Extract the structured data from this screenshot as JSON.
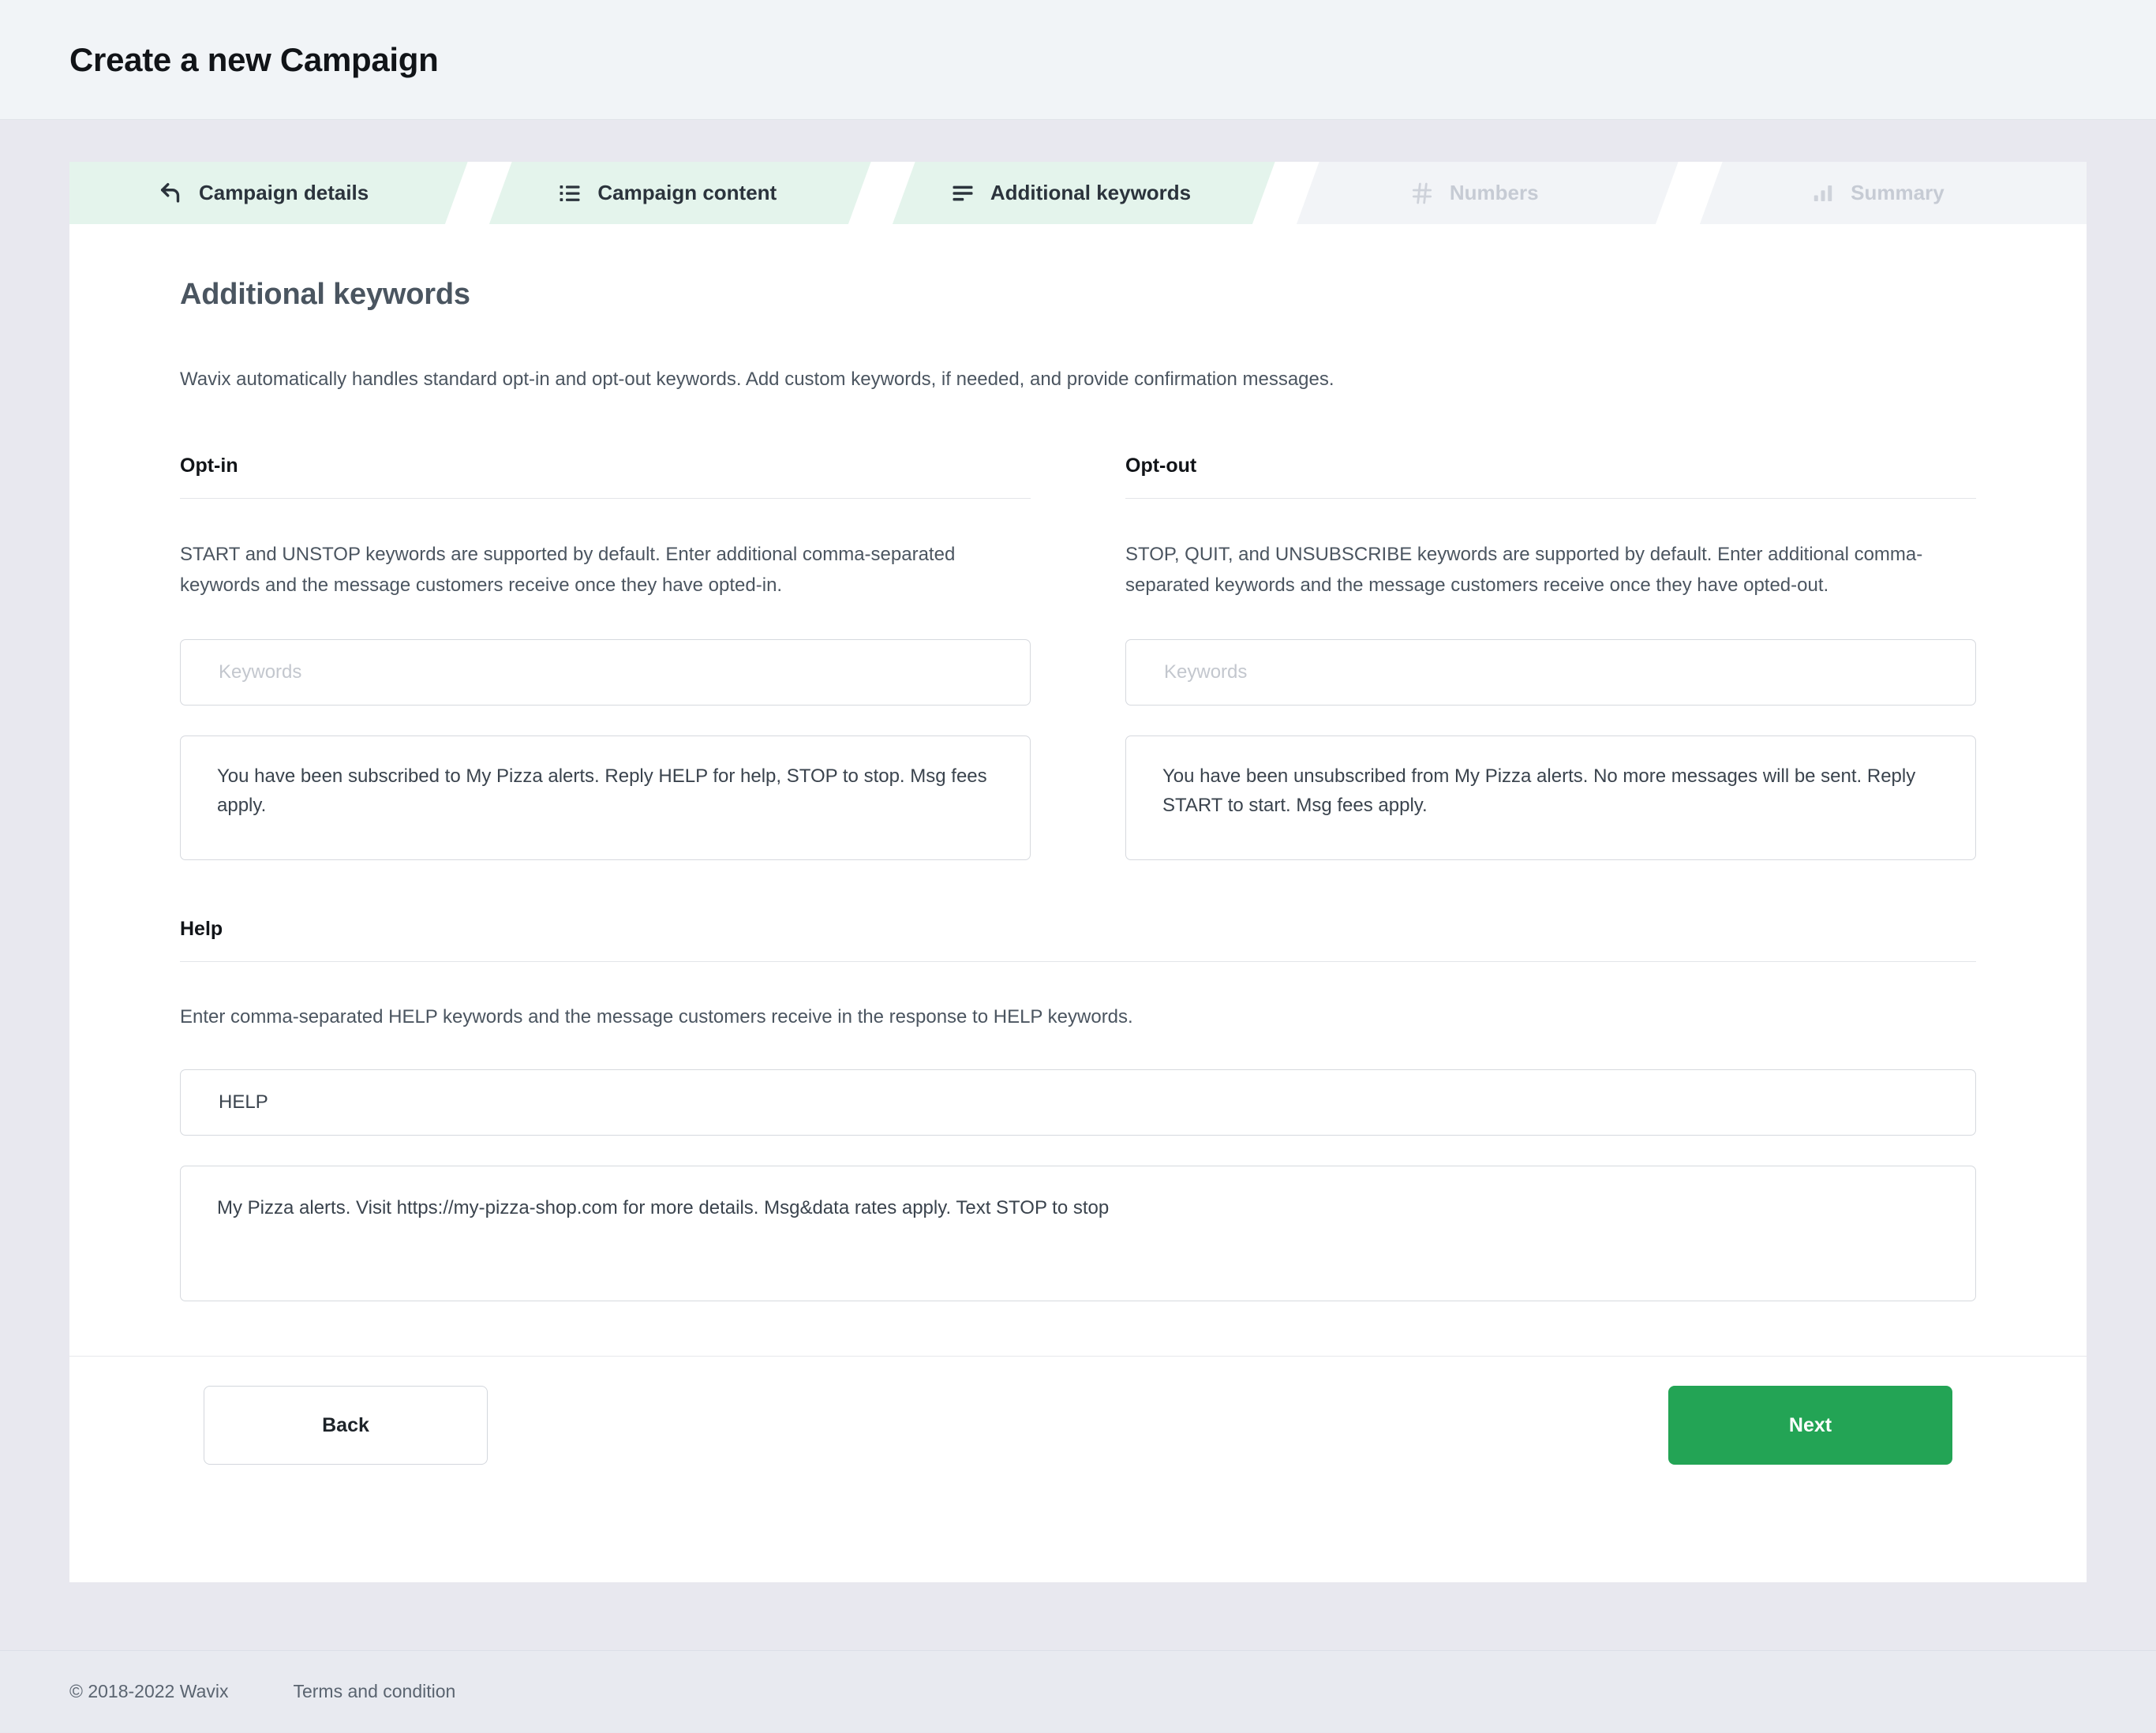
{
  "header": {
    "title": "Create a new Campaign"
  },
  "stepper": {
    "steps": [
      {
        "label": "Campaign details",
        "icon": "back-arrow-icon",
        "state": "active"
      },
      {
        "label": "Campaign content",
        "icon": "bullet-list-icon",
        "state": "active"
      },
      {
        "label": "Additional keywords",
        "icon": "align-left-icon",
        "state": "active"
      },
      {
        "label": "Numbers",
        "icon": "hash-icon",
        "state": "inactive"
      },
      {
        "label": "Summary",
        "icon": "bar-chart-icon",
        "state": "inactive"
      }
    ]
  },
  "main": {
    "title": "Additional keywords",
    "description": "Wavix automatically handles standard opt-in and opt-out keywords. Add custom keywords, if needed, and provide confirmation messages.",
    "optin": {
      "heading": "Opt-in",
      "text": "START and UNSTOP keywords are supported by default. Enter additional comma-separated keywords and the message customers receive once they have opted-in.",
      "keywords_placeholder": "Keywords",
      "keywords_value": "",
      "message_value": "You have been subscribed to My Pizza alerts. Reply HELP for help, STOP to stop. Msg fees apply."
    },
    "optout": {
      "heading": "Opt-out",
      "text": "STOP, QUIT, and UNSUBSCRIBE keywords are supported by default. Enter additional comma-separated keywords and the message customers receive once they have opted-out.",
      "keywords_placeholder": "Keywords",
      "keywords_value": "",
      "message_value": "You have been unsubscribed from My Pizza alerts. No more messages will be sent. Reply START to start. Msg fees apply."
    },
    "help": {
      "heading": "Help",
      "text": "Enter comma-separated HELP keywords and the message customers receive in the response to HELP keywords.",
      "keywords_value": "HELP",
      "keywords_placeholder": "Keywords",
      "message_value": "My Pizza alerts. Visit https://my-pizza-shop.com for more details. Msg&data rates apply. Text STOP to stop"
    }
  },
  "actions": {
    "back_label": "Back",
    "next_label": "Next"
  },
  "footer": {
    "copyright": "© 2018-2022 Wavix",
    "terms_label": "Terms and condition"
  },
  "colors": {
    "accent_green": "#23a455",
    "tab_active_bg": "#e4f4ec",
    "tab_inactive_bg": "#f2f4f7",
    "page_bg": "#e8e8ef",
    "header_bg": "#f1f4f7"
  }
}
